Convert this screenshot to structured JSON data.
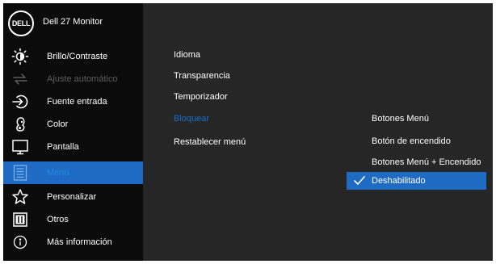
{
  "header": {
    "logo_text": "DELL",
    "model_name": "Dell 27 Monitor"
  },
  "menu": [
    {
      "label": "Brillo/Contraste",
      "icon": "brightness-icon",
      "state": "normal"
    },
    {
      "label": "Ajuste automático",
      "icon": "auto-adjust-icon",
      "state": "disabled"
    },
    {
      "label": "Fuente entrada",
      "icon": "input-source-icon",
      "state": "normal"
    },
    {
      "label": "Color",
      "icon": "color-palette-icon",
      "state": "normal"
    },
    {
      "label": "Pantalla",
      "icon": "display-icon",
      "state": "normal"
    },
    {
      "label": "Menú",
      "icon": "menu-icon",
      "state": "selected"
    },
    {
      "label": "Personalizar",
      "icon": "star-icon",
      "state": "normal"
    },
    {
      "label": "Otros",
      "icon": "others-icon",
      "state": "normal"
    },
    {
      "label": "Más información",
      "icon": "info-icon",
      "state": "normal"
    }
  ],
  "submenu": [
    {
      "label": "Idioma",
      "active": false
    },
    {
      "label": "Transparencia",
      "active": false
    },
    {
      "label": "Temporizador",
      "active": false
    },
    {
      "label": "Bloquear",
      "active": true
    },
    {
      "label": "Restablecer menú",
      "active": false
    }
  ],
  "options": [
    {
      "label": "Botones Menú",
      "selected": false
    },
    {
      "label": "Botón de encendido",
      "selected": false
    },
    {
      "label": "Botones Menú + Encendido",
      "selected": false
    },
    {
      "label": "Deshabilitado",
      "selected": true
    }
  ],
  "colors": {
    "accent": "#1f6bc4",
    "highlight_text": "#1a6ec8",
    "sidebar_bg": "#0b0b0b",
    "panel_bg": "#262626",
    "disabled_text": "#5e5e5e"
  }
}
